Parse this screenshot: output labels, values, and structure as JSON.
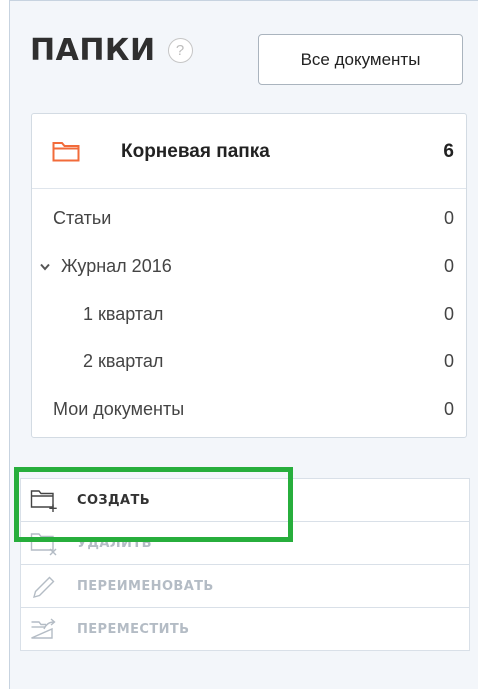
{
  "header": {
    "title": "ПАПКИ",
    "help_glyph": "?",
    "all_docs_label": "Все документы"
  },
  "tree": {
    "root": {
      "label": "Корневая папка",
      "count": "6",
      "icon": "folder-icon"
    },
    "items": [
      {
        "label": "Статьи",
        "count": "0"
      },
      {
        "label": "Журнал 2016",
        "count": "0",
        "expanded": true
      },
      {
        "label": "1 квартал",
        "count": "0"
      },
      {
        "label": "2 квартал",
        "count": "0"
      },
      {
        "label": "Мои документы",
        "count": "0"
      }
    ]
  },
  "actions": [
    {
      "label": "СОЗДАТЬ",
      "icon": "create-folder-icon",
      "enabled": true
    },
    {
      "label": "УДАЛИТЬ",
      "icon": "delete-folder-icon",
      "enabled": false
    },
    {
      "label": "ПЕРЕИМЕНОВАТЬ",
      "icon": "pencil-icon",
      "enabled": false
    },
    {
      "label": "ПЕРЕМЕСТИТЬ",
      "icon": "move-folder-icon",
      "enabled": false
    }
  ],
  "colors": {
    "folder_accent": "#f26b3a",
    "highlight": "#27ae3c",
    "disabled_text": "#b4bcc5"
  }
}
